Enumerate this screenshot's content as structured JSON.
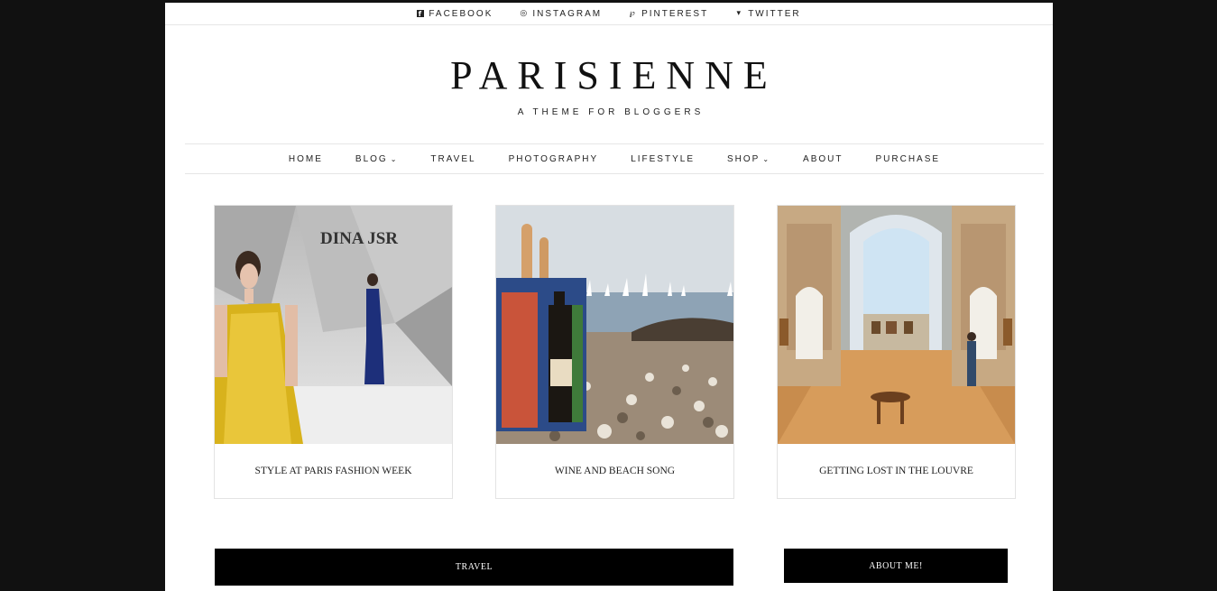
{
  "social": {
    "facebook": "FACEBOOK",
    "instagram": "INSTAGRAM",
    "pinterest": "PINTEREST",
    "twitter": "TWITTER"
  },
  "header": {
    "logo": "PARISIENNE",
    "tagline": "A THEME FOR BLOGGERS"
  },
  "nav": {
    "items": [
      {
        "label": "HOME"
      },
      {
        "label": "BLOG"
      },
      {
        "label": "TRAVEL"
      },
      {
        "label": "PHOTOGRAPHY"
      },
      {
        "label": "LIFESTYLE"
      },
      {
        "label": "SHOP"
      },
      {
        "label": "ABOUT"
      },
      {
        "label": "PURCHASE"
      }
    ]
  },
  "posts": [
    {
      "title": "STYLE AT PARIS FASHION WEEK",
      "image_text": "DINA JSR"
    },
    {
      "title": "WINE AND BEACH SONG"
    },
    {
      "title": "GETTING LOST IN THE LOUVRE"
    }
  ],
  "sections": {
    "travel": "TRAVEL",
    "about": "ABOUT ME!"
  }
}
